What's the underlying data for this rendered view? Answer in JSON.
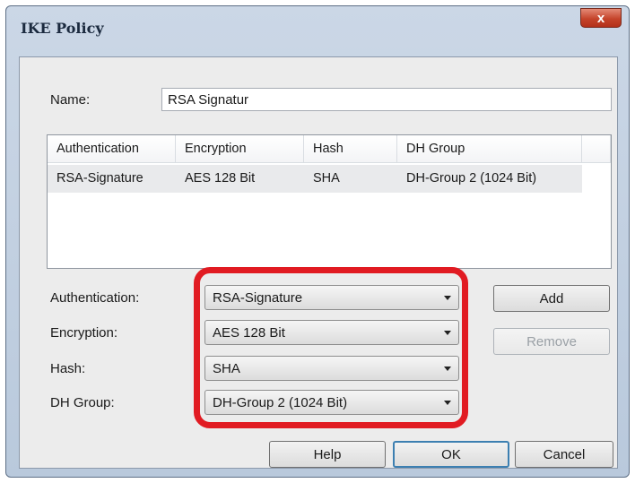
{
  "window": {
    "title": "IKE Policy",
    "close_glyph": "x"
  },
  "name_field": {
    "label": "Name:",
    "value": "RSA Signatur"
  },
  "list": {
    "columns": [
      "Authentication",
      "Encryption",
      "Hash",
      "DH Group"
    ],
    "rows": [
      [
        "RSA-Signature",
        "AES 128 Bit",
        "SHA",
        "DH-Group 2 (1024 Bit)"
      ]
    ]
  },
  "fields": {
    "authentication": {
      "label": "Authentication:",
      "value": "RSA-Signature"
    },
    "encryption": {
      "label": "Encryption:",
      "value": "AES 128 Bit"
    },
    "hash": {
      "label": "Hash:",
      "value": "SHA"
    },
    "dh_group": {
      "label": "DH Group:",
      "value": "DH-Group 2 (1024 Bit)"
    }
  },
  "buttons": {
    "add": "Add",
    "remove": "Remove",
    "help": "Help",
    "ok": "OK",
    "cancel": "Cancel"
  },
  "colors": {
    "highlight": "#e11b22",
    "title_bar": "#cbd7e6"
  },
  "icons": {
    "close": "close-icon",
    "dropdown": "chevron-down-icon"
  }
}
